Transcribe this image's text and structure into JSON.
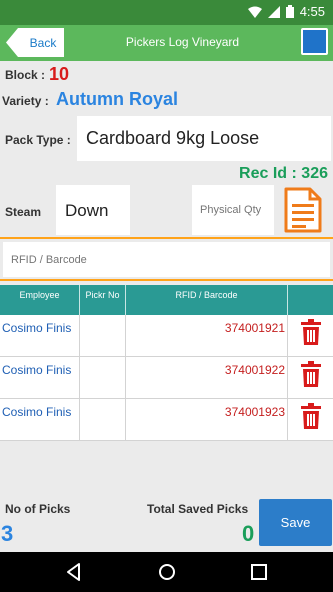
{
  "status_bar": {
    "time": "4:55"
  },
  "app_bar": {
    "back_label": "Back",
    "title": "Pickers Log Vineyard"
  },
  "form": {
    "block_label": "Block :",
    "block_value": "10",
    "variety_label": "Variety :",
    "variety_value": "Autumn Royal",
    "pack_type_label": "Pack Type :",
    "pack_type_value": "Cardboard 9kg Loose",
    "rec_id_label": "Rec Id :",
    "rec_id_value": "326",
    "steam_label": "Steam",
    "steam_value": "Down",
    "physical_qty_placeholder": "Physical Qty",
    "rfid_placeholder": "RFID / Barcode"
  },
  "table": {
    "headers": [
      "Employee",
      "Pickr No",
      "RFID / Barcode",
      ""
    ],
    "rows": [
      {
        "employee": "Cosimo Finis",
        "picker_no": "",
        "rfid": "374001921"
      },
      {
        "employee": "Cosimo Finis",
        "picker_no": "",
        "rfid": "374001922"
      },
      {
        "employee": "Cosimo Finis",
        "picker_no": "",
        "rfid": "374001923"
      }
    ]
  },
  "footer": {
    "no_of_picks_label": "No of Picks",
    "no_of_picks_value": "3",
    "total_saved_label": "Total Saved Picks",
    "total_saved_value": "0",
    "save_label": "Save"
  },
  "colors": {
    "status_bar": "#3a8a3a",
    "app_bar": "#5cb85c",
    "accent_blue": "#2c7dc9",
    "table_header": "#2a9a94",
    "block_red": "#d81b1b",
    "rec_green": "#1a9e5a",
    "rfid_underline": "#ffa31a"
  },
  "icons": [
    "wifi-icon",
    "signal-icon",
    "battery-icon",
    "document-icon",
    "trash-icon",
    "back-nav-icon",
    "home-nav-icon",
    "recents-nav-icon"
  ]
}
